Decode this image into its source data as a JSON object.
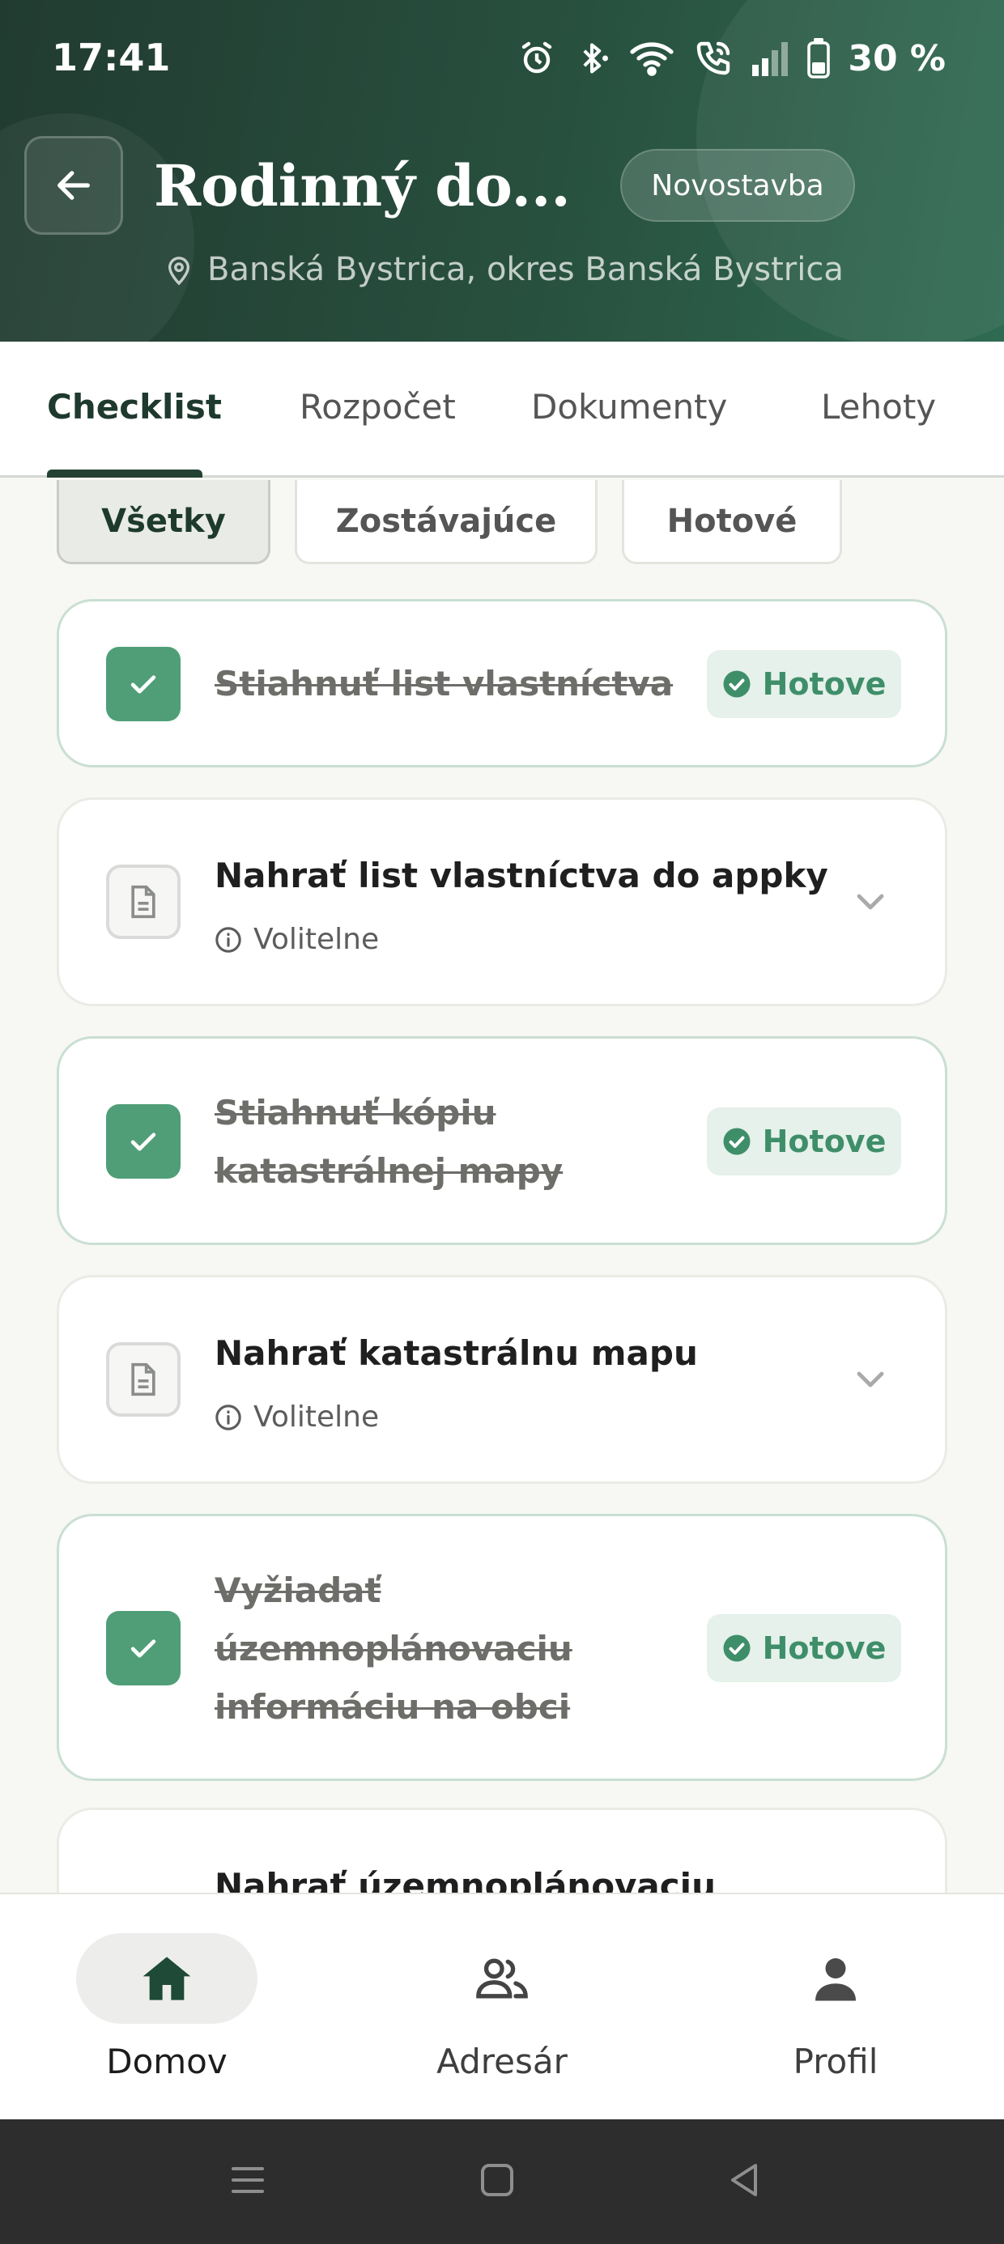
{
  "status_bar": {
    "time": "17:41",
    "battery": "30 %"
  },
  "header": {
    "title": "Rodinný do...",
    "type_badge": "Novostavba",
    "location": "Banská Bystrica, okres Banská Bystrica"
  },
  "tabs": [
    {
      "label": "Checklist",
      "active": true
    },
    {
      "label": "Rozpočet"
    },
    {
      "label": "Dokumenty"
    },
    {
      "label": "Lehoty"
    }
  ],
  "filters": [
    {
      "label": "Všetky",
      "active": true
    },
    {
      "label": "Zostávajúce"
    },
    {
      "label": "Hotové"
    }
  ],
  "tasks": [
    {
      "title": "Stiahnuť list vlastníctva",
      "done": true,
      "badge": "Hotove"
    },
    {
      "title": "Nahrať list vlastníctva do appky",
      "done": false,
      "note": "Volitelne"
    },
    {
      "title_lines": [
        "Stiahnuť kópiu",
        "katastrálnej mapy"
      ],
      "done": true,
      "badge": "Hotove"
    },
    {
      "title": "Nahrať katastrálnu mapu",
      "done": false,
      "note": "Volitelne"
    },
    {
      "title_lines": [
        "Vyžiadať",
        "územnoplánovaciu",
        "informáciu na obci"
      ],
      "done": true,
      "badge": "Hotove"
    },
    {
      "title": "Nahrať územnoplánovaciu",
      "done": false
    }
  ],
  "bottom_nav": [
    {
      "label": "Domov",
      "icon": "home-icon",
      "active": true
    },
    {
      "label": "Adresár",
      "icon": "contacts-icon"
    },
    {
      "label": "Profil",
      "icon": "person-icon"
    }
  ],
  "colors": {
    "primary": "#234234",
    "accent": "#4f9e78",
    "badge_bg": "#e5f1ea"
  }
}
